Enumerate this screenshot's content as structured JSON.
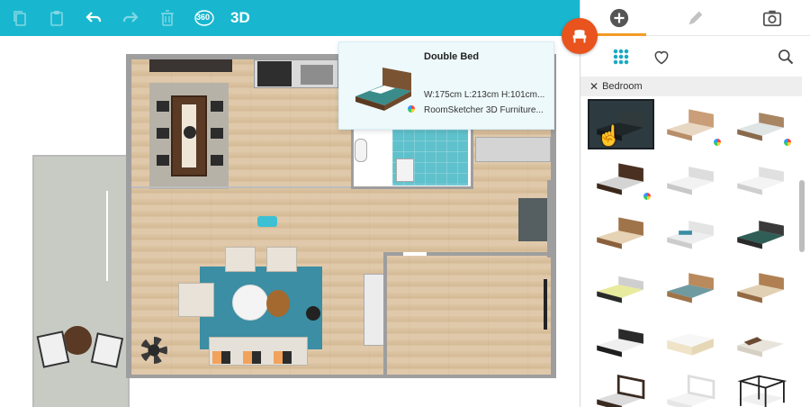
{
  "toolbar": {
    "copy_icon": "copy-icon",
    "paste_icon": "paste-icon",
    "undo_icon": "undo-icon",
    "redo_icon": "redo-icon",
    "delete_icon": "trash-icon",
    "view360_label": "360",
    "view3d_label": "3D"
  },
  "panel": {
    "tabs": [
      {
        "icon": "plus-circle-icon",
        "active": true
      },
      {
        "icon": "pencil-icon",
        "active": false
      },
      {
        "icon": "camera-icon",
        "active": false
      }
    ],
    "filter_label": "Bedroom",
    "items_count": 18
  },
  "tooltip": {
    "title": "Double Bed",
    "dims": "W:175cm L:213cm H:101cm...",
    "brand": "RoomSketcher 3D Furniture..."
  },
  "colors": {
    "toolbar": "#18b7cf",
    "accent": "#f39c25",
    "fab": "#e8531e",
    "rug": "#3b8ea3"
  }
}
